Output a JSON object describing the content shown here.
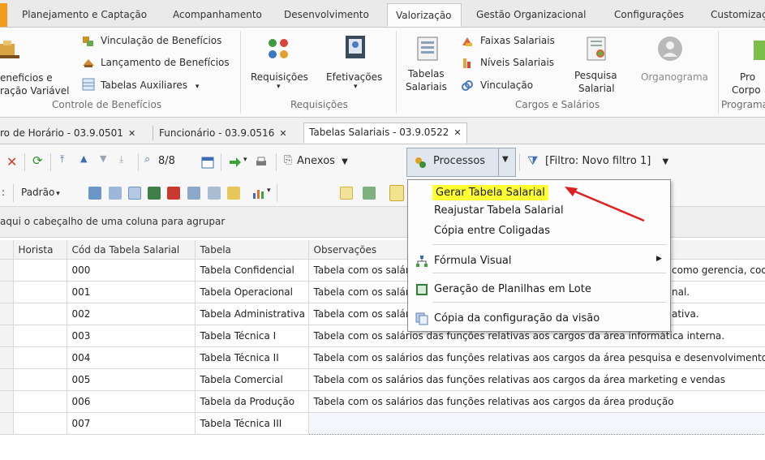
{
  "ribbon_tabs": [
    "Planejamento e Captação",
    "Acompanhamento",
    "Desenvolvimento",
    "Valorização",
    "Gestão Organizacional",
    "Configurações",
    "Customizaç"
  ],
  "ribbon": {
    "beneficios_left_line1": "eneficios e",
    "beneficios_left_line2": "ração Variável",
    "vinculacao_beneficios": "Vinculação de Benefícios",
    "lancamento_beneficios": "Lançamento de Benefícios",
    "tabelas_auxiliares": "Tabelas Auxiliares",
    "group_controle": "Controle de Benefícios",
    "requisicoes": "Requisições",
    "efetivacoes": "Efetivações",
    "group_requisicoes": "Requisições",
    "tabelas_salariais_1": "Tabelas",
    "tabelas_salariais_2": "Salariais",
    "faixas_salariais": "Faixas Salariais",
    "niveis_salariais": "Níveis Salariais",
    "vinculacao": "Vinculação",
    "pesquisa_salarial_1": "Pesquisa",
    "pesquisa_salarial_2": "Salarial",
    "organograma": "Organograma",
    "group_cargos": "Cargos e Salários",
    "pro_1": "Pro",
    "pro_2": "Corpo",
    "group_programa": "Programa"
  },
  "doc_tabs": [
    {
      "label": "ro de Horário - 03.9.0501",
      "close": "✕"
    },
    {
      "label": "Funcionário - 03.9.0516",
      "close": "✕"
    },
    {
      "label": "Tabelas Salariais - 03.9.0522",
      "close": "✕"
    }
  ],
  "toolbar": {
    "record_counter": "8/8",
    "anexos": "Anexos",
    "processos": "Processos",
    "filtro": "[Filtro: Novo filtro 1]",
    "padrao": "Padrão"
  },
  "group_hint": "aqui o cabeçalho de uma coluna para agrupar",
  "grid": {
    "columns": [
      "Horista",
      "Cód da Tabela Salarial",
      "Tabela",
      "Observações"
    ],
    "rows": [
      {
        "cod": "000",
        "tabela": "Tabela Confidencial",
        "obs_left": "Tabela com os salári",
        "obs_right": "como gerencia, coo"
      },
      {
        "cod": "001",
        "tabela": "Tabela Operacional",
        "obs_left": "Tabela com os salári",
        "obs_right": "nal."
      },
      {
        "cod": "002",
        "tabela": "Tabela Administrativa",
        "obs_left": "Tabela com os salári",
        "obs_right": "ativa."
      },
      {
        "cod": "003",
        "tabela": "Tabela Técnica I",
        "obs_left": "Tabela com os salários das funções relativas aos cargos da área informática interna.",
        "obs_right": ""
      },
      {
        "cod": "004",
        "tabela": "Tabela Técnica II",
        "obs_left": "Tabela com os salários das funções relativas aos cargos da área pesquisa e desenvolvimento",
        "obs_right": ""
      },
      {
        "cod": "005",
        "tabela": "Tabela Comercial",
        "obs_left": "Tabela com os salários das funções relativas aos cargos da área marketing e vendas",
        "obs_right": ""
      },
      {
        "cod": "006",
        "tabela": "Tabela da Produção",
        "obs_left": "Tabela com os salários das funções relativas aos cargos da área produção",
        "obs_right": ""
      },
      {
        "cod": "007",
        "tabela": "Tabela Técnica III",
        "obs_left": "",
        "obs_right": ""
      }
    ]
  },
  "menu": {
    "gerar": "Gerar Tabela Salarial",
    "reajustar": "Reajustar Tabela Salarial",
    "copia_coligadas": "Cópia entre Coligadas",
    "formula_visual": "Fórmula Visual",
    "geracao_planilhas": "Geração de Planilhas em Lote",
    "copia_config": "Cópia da configuração da visão"
  },
  "colors": {
    "highlight": "#ffff33",
    "arrow": "#e02020",
    "accent_orange": "#f39b1d"
  }
}
